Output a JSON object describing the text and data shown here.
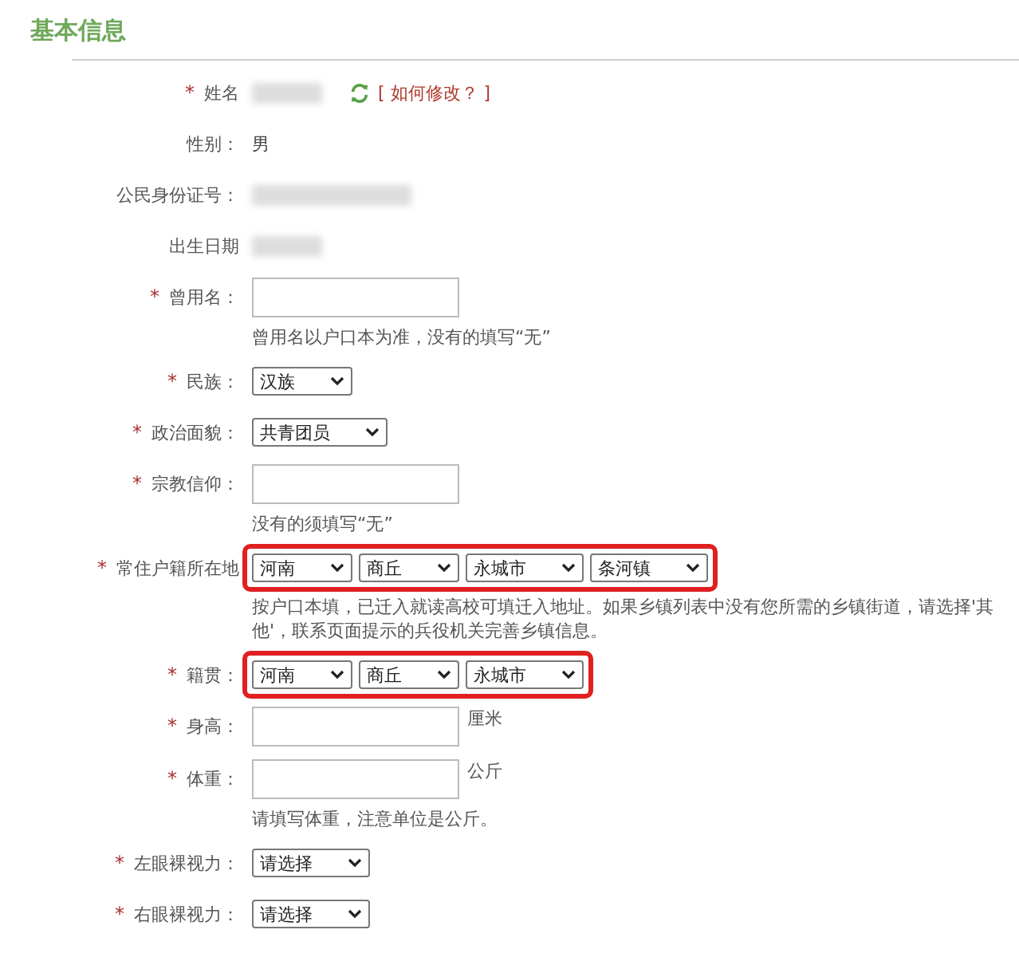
{
  "title": "基本信息",
  "rows": [
    {
      "kind": "redacted",
      "mark": "*",
      "label": "姓名",
      "link": "[ 如何修改？ ]"
    },
    {
      "kind": "text",
      "label": "性别：",
      "value": "男"
    },
    {
      "kind": "redacted",
      "label": "公民身份证号：",
      "wide": true
    },
    {
      "kind": "redacted",
      "label": "出生日期"
    },
    {
      "kind": "input",
      "mark": "*",
      "label": "曾用名：",
      "hint": "曾用名以户口本为准，没有的填写“无”"
    },
    {
      "kind": "select",
      "mark": "*",
      "label": "民族：",
      "options": [
        {
          "value": "汉族"
        }
      ]
    },
    {
      "kind": "select",
      "mark": "*",
      "label": "政治面貌：",
      "options": [
        {
          "value": "共青团员"
        }
      ]
    },
    {
      "kind": "input",
      "mark": "*",
      "label": "宗教信仰：",
      "hint": "没有的须填写“无”"
    },
    {
      "kind": "select",
      "mark": "*",
      "label": "常住户籍所在地",
      "highlighted": true,
      "options": [
        {
          "value": "河南"
        },
        {
          "value": "商丘"
        },
        {
          "value": "永城市"
        },
        {
          "value": "条河镇"
        }
      ],
      "hint": "按户口本填，已迁入就读高校可填迁入地址。如果乡镇列表中没有您所需的乡镇街道，请选择'其他'，联系页面提示的兵役机关完善乡镇信息。"
    },
    {
      "kind": "select",
      "mark": "*",
      "label": "籍贯：",
      "highlighted": true,
      "options": [
        {
          "value": "河南"
        },
        {
          "value": "商丘"
        },
        {
          "value": "永城市"
        }
      ]
    },
    {
      "kind": "input",
      "mark": "*",
      "label": "身高：",
      "unit": "厘米"
    },
    {
      "kind": "input",
      "mark": "*",
      "label": "体重：",
      "unit": "公斤",
      "hint": "请填写体重，注意单位是公斤。"
    },
    {
      "kind": "select",
      "mark": "*",
      "label": "左眼裸视力：",
      "options": [
        {
          "value": "请选择"
        }
      ]
    },
    {
      "kind": "select",
      "mark": "*",
      "label": "右眼裸视力：",
      "options": [
        {
          "value": "请选择"
        }
      ]
    }
  ]
}
